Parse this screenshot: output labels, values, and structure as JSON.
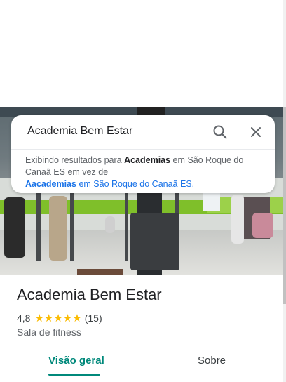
{
  "search": {
    "query": "Academia Bem Estar"
  },
  "notice": {
    "prefix": "Exibindo resultados para ",
    "corrected_term": "Academias",
    "middle": " em São Roque do Canaã ES em vez de",
    "original_term": "Aacademias",
    "suffix": " em São Roque do Canaã ES."
  },
  "place": {
    "name": "Academia Bem Estar",
    "rating": "4,8",
    "stars": "★★★★★",
    "review_count": "(15)",
    "category": "Sala de fitness"
  },
  "tabs": [
    {
      "label": "Visão geral",
      "selected": true
    },
    {
      "label": "Sobre",
      "selected": false
    }
  ],
  "colors": {
    "accent": "#00897b",
    "star": "#fbbc04",
    "link": "#1a73e8"
  },
  "icons": [
    "search-icon",
    "close-icon"
  ]
}
